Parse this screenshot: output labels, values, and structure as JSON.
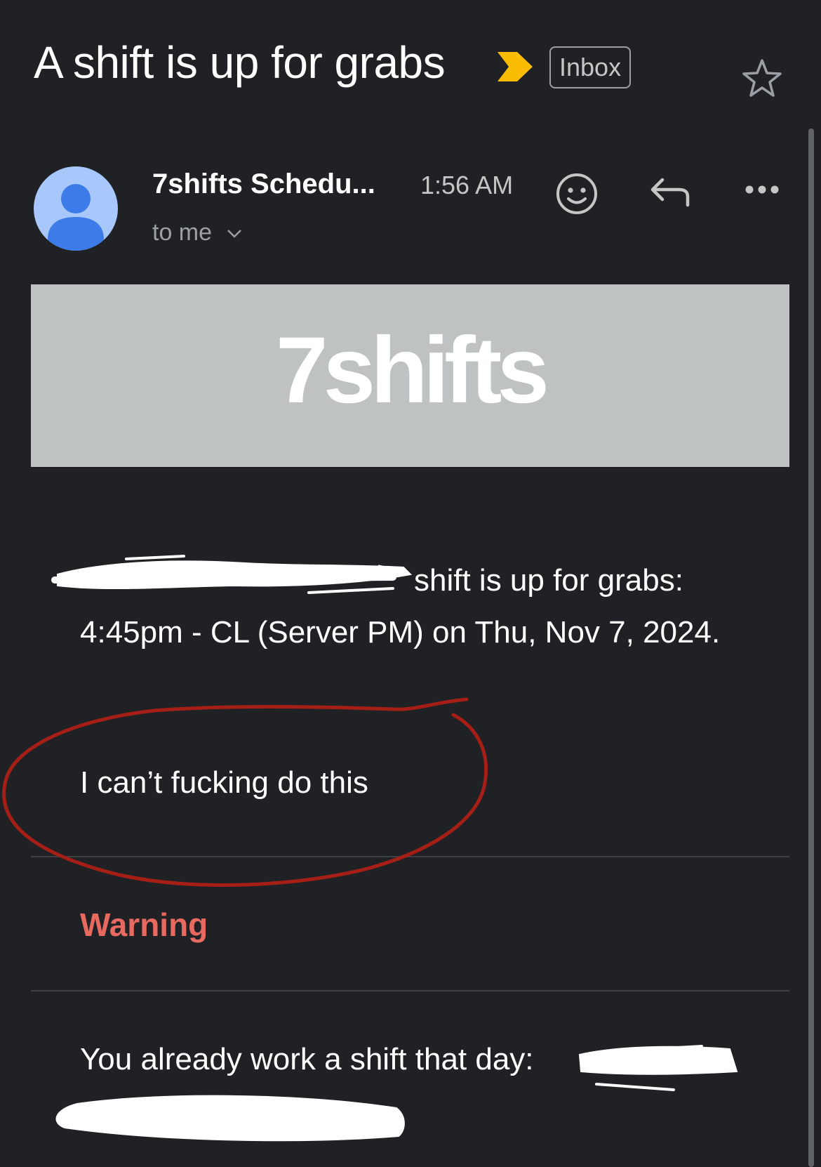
{
  "header": {
    "subject": "A shift is up for grabs",
    "label": "Inbox"
  },
  "sender": {
    "name": "7shifts Schedu...",
    "time": "1:56 AM",
    "recipient": "to me"
  },
  "banner": {
    "brand": "7shifts"
  },
  "body": {
    "paragraph1": "shift is up for grabs: 4:45pm - CL (Server PM) on Thu, Nov 7, 2024.",
    "paragraph2": "I can’t fucking do this",
    "warning": "Warning",
    "paragraph3": "You already work a shift that day:"
  },
  "colors": {
    "background": "#202124",
    "importance_marker": "#fbbc04",
    "warning": "#e8695f",
    "annotation": "#a51f17",
    "avatar": "#a8c7fa"
  },
  "icons": [
    "importance-marker-icon",
    "star-icon",
    "avatar-person-icon",
    "chevron-down-icon",
    "emoji-reaction-icon",
    "reply-icon",
    "more-options-icon"
  ]
}
